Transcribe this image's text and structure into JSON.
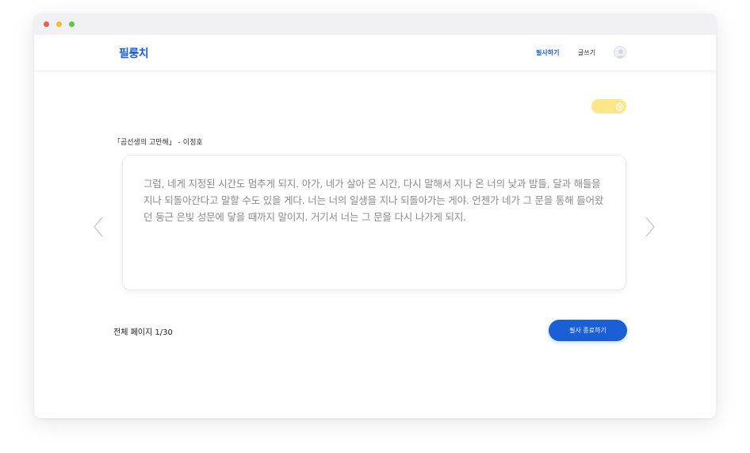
{
  "app": {
    "logo": "필룽치"
  },
  "nav": {
    "items": [
      {
        "label": "필사하기",
        "active": true
      },
      {
        "label": "글쓰기",
        "active": false
      }
    ]
  },
  "icons": {
    "avatar": "user-avatar-icon",
    "toggle": "settings-gear-icon",
    "prev": "chevron-left-icon",
    "next": "chevron-right-icon"
  },
  "colors": {
    "brand": "#1a5fd6",
    "toggle": "#fde68a",
    "passage_text": "#8a8a8a"
  },
  "content": {
    "source": "「곰선생의 고만해」 - 이정호",
    "passage": "그럼, 네게 지정된 시간도 멈추게 되지. 아가, 네가 살아 온 시간, 다시 말해서 지나 온 너의 낮과 밤들, 달과 해들을 지나 되돌아간다고 말할 수도 있을 게다. 너는 너의 일생을 지나 되돌아가는 게야. 언젠가 네가 그 문을 통해 들어왔던 둥근 은빛 성문에 닿을 때까지 말이지. 거기서 너는 그 문을 다시 나가게 되지."
  },
  "footer": {
    "page_count": "전체 페이지 1/30",
    "finish_button": "필사 종료하기"
  }
}
